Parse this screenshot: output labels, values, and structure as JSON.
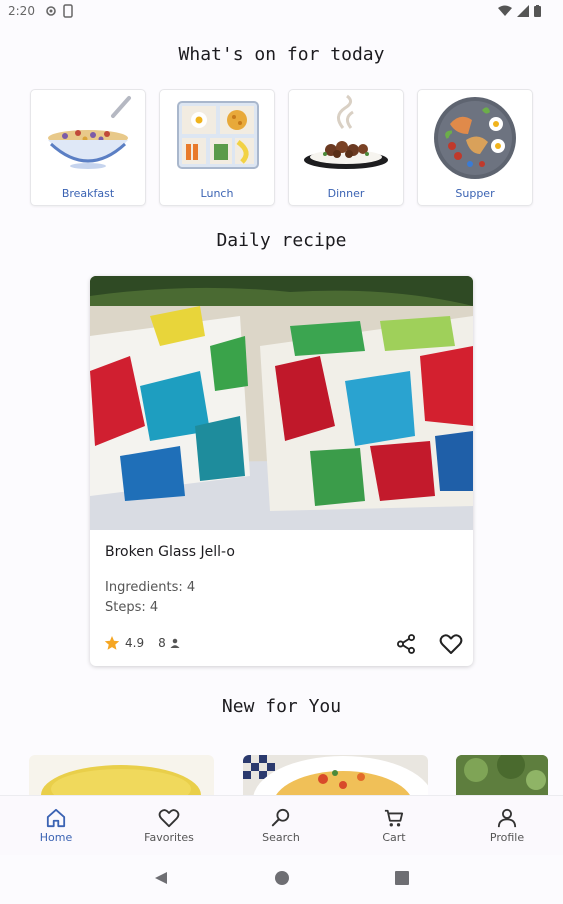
{
  "status_bar": {
    "time": "2:20",
    "notification_icons": [
      "cast-icon",
      "sim-icon"
    ],
    "right_icons": [
      "wifi-icon",
      "signal-icon",
      "battery-icon"
    ]
  },
  "today": {
    "title": "What's on for today",
    "categories": [
      {
        "label": "Breakfast",
        "icon": "breakfast-icon"
      },
      {
        "label": "Lunch",
        "icon": "lunch-icon"
      },
      {
        "label": "Dinner",
        "icon": "dinner-icon"
      },
      {
        "label": "Supper",
        "icon": "supper-icon"
      }
    ]
  },
  "daily_recipe": {
    "title": "Daily recipe",
    "name": "Broken Glass Jell-o",
    "ingredients": "Ingredients: 4",
    "steps": "Steps: 4",
    "rating": "4.9",
    "count": "8"
  },
  "new_for_you": {
    "title": "New for You"
  },
  "bottom_nav": {
    "items": [
      {
        "label": "Home",
        "icon": "home-icon",
        "active": true
      },
      {
        "label": "Favorites",
        "icon": "heart-icon",
        "active": false
      },
      {
        "label": "Search",
        "icon": "search-icon",
        "active": false
      },
      {
        "label": "Cart",
        "icon": "cart-icon",
        "active": false
      },
      {
        "label": "Profile",
        "icon": "profile-icon",
        "active": false
      }
    ]
  },
  "colors": {
    "accent": "#3b63b3",
    "star": "#f5a623",
    "background": "#fcfbfe"
  }
}
